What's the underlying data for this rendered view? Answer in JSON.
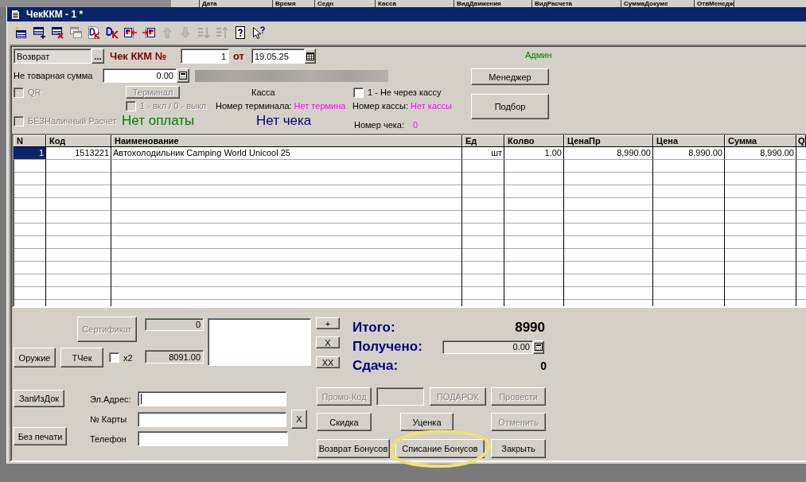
{
  "background_window": {
    "columns": [
      "Дата",
      "Время",
      "Седн",
      "Касса",
      "ВидДвижения",
      "ВидРасчета",
      "СуммаДокуме",
      "ОтвМенедж"
    ]
  },
  "window": {
    "title": "ЧекККМ - 1 *"
  },
  "toolbar": [
    {
      "kind": "newrow",
      "disabled": false
    },
    {
      "kind": "addrow",
      "disabled": false
    },
    {
      "kind": "deleterow",
      "disabled": false
    },
    {
      "kind": "copyrow",
      "disabled": true
    },
    {
      "kind": "docdk",
      "disabled": false
    },
    {
      "kind": "dk",
      "disabled": false
    },
    {
      "kind": "movein",
      "disabled": false
    },
    {
      "kind": "moveout",
      "disabled": false
    },
    {
      "kind": "up",
      "disabled": true
    },
    {
      "kind": "down",
      "disabled": true
    },
    {
      "kind": "sortasc",
      "disabled": true
    },
    {
      "kind": "sortdesc",
      "disabled": true
    },
    {
      "kind": "help",
      "disabled": false
    },
    {
      "kind": "pointerhelp",
      "disabled": false
    }
  ],
  "header": {
    "operation": {
      "value": "Возврат",
      "button": "..."
    },
    "receipt_label": "Чек ККМ №",
    "receipt_number": "1",
    "date_label": "от",
    "date": "19.05.25",
    "user": "Админ",
    "non_goods_sum": {
      "label": "Не товарная сумма",
      "value": "0.00"
    },
    "manager_button": "Менеджер",
    "qr": {
      "label": "QR",
      "checked": false,
      "disabled": true
    },
    "terminal_button": {
      "label": "Терминал",
      "disabled": true
    },
    "kassa_label": "Касса",
    "not_via_kassa": {
      "label": "1 - Не через кассу",
      "checked": false,
      "disabled": false
    },
    "select_button": "Подбор",
    "terminal_toggle": {
      "label": "1 - вкл / 0 - выкл",
      "checked": false,
      "disabled": true
    },
    "terminal_number": {
      "label": "Номер терминала:",
      "value": "Нет термина"
    },
    "kassa_number": {
      "label": "Номер кассы:",
      "value": "Нет кассы"
    },
    "cashless": {
      "label": "БЕЗНаличный Расчет",
      "checked": false,
      "disabled": true
    },
    "payment_status": "Нет оплаты",
    "receipt_status": "Нет чека",
    "receipt_no": {
      "label": "Номер чека:",
      "value": "0"
    }
  },
  "table": {
    "columns": [
      "N",
      "Код",
      "Наименование",
      "Ед",
      "Колво",
      "ЦенаПр",
      "Цена",
      "Сумма",
      "Q"
    ],
    "rows": [
      {
        "selected": true,
        "cells": [
          "1",
          "1513221",
          "Автохолодильник Camping World Unicool 25",
          "шт",
          "1.00",
          "8,990.00",
          "8,990.00",
          "8,990.00"
        ]
      }
    ]
  },
  "bottom": {
    "certificate": {
      "label": "Сертификат",
      "disabled": true,
      "value": "0"
    },
    "side_buttons": [
      "+",
      "X",
      "XX"
    ],
    "weapon_button": "Оружие",
    "tcheck_button": "ТЧек",
    "double": {
      "label": "x2",
      "checked": false
    },
    "amount": {
      "value": "8091.00",
      "disabled": true
    },
    "totals": [
      {
        "kind": "text",
        "label": "Итого:",
        "value": "8990"
      },
      {
        "kind": "field",
        "label": "Получено:",
        "value": "0.00"
      },
      {
        "kind": "text",
        "label": "Сдача:",
        "value": "0"
      }
    ],
    "left_buttons": [
      "ЗапИзДок",
      "Без печати"
    ],
    "contacts": [
      {
        "label": "Эл.Адрес:",
        "focused": true
      },
      {
        "label": "№ Карты",
        "focused": false,
        "clear_button": "X"
      },
      {
        "label": "Телефон",
        "focused": false
      }
    ],
    "actions": [
      [
        {
          "kind": "button",
          "label": "Промо-Код",
          "disabled": true,
          "highlighted": false
        },
        {
          "kind": "field",
          "disabled": true
        },
        {
          "kind": "button",
          "label": "ПОДАРОК",
          "disabled": true,
          "highlighted": false
        },
        {
          "kind": "button",
          "label": "Провести",
          "disabled": true,
          "highlighted": false
        }
      ],
      [
        {
          "kind": "button",
          "label": "Скидка",
          "disabled": false,
          "highlighted": false
        },
        {
          "kind": "button",
          "label": "Уценка",
          "disabled": false,
          "highlighted": false
        },
        {
          "kind": "button",
          "label": "Отменить",
          "disabled": true,
          "highlighted": false
        }
      ],
      [
        {
          "kind": "button",
          "label": "Возврат Бонусов",
          "disabled": false,
          "highlighted": false
        },
        {
          "kind": "button",
          "label": "Списание Бонусов",
          "disabled": false,
          "highlighted": true
        },
        {
          "kind": "button",
          "label": "Закрыть",
          "disabled": false,
          "highlighted": false
        }
      ]
    ]
  }
}
